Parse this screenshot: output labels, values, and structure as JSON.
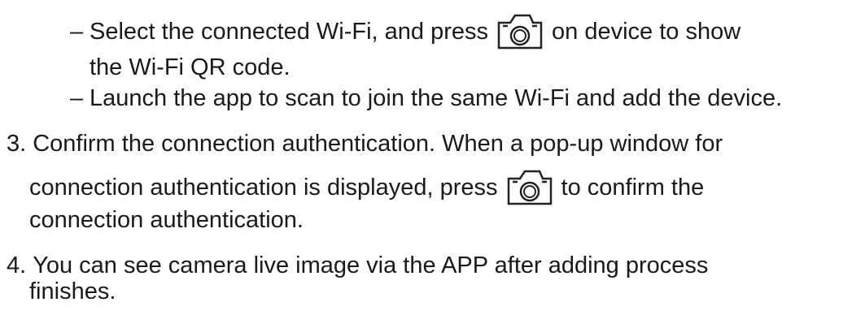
{
  "instructions": {
    "sub_steps": [
      {
        "marker": "–",
        "text_before": "Select the connected Wi-Fi, and press",
        "icon": "camera-icon",
        "text_after": "on device to show",
        "continuation": "the Wi-Fi QR code."
      },
      {
        "marker": "–",
        "text": "Launch the app to scan to join the same Wi-Fi and add the device."
      }
    ],
    "steps": [
      {
        "number": "3.",
        "line1": "Confirm the connection authentication. When a pop-up window for",
        "line2_before": "connection authentication is displayed, press",
        "icon": "camera-icon",
        "line2_after": "to confirm the",
        "line3": "connection authentication."
      },
      {
        "number": "4.",
        "line1": "You can see camera live image via the APP after adding process",
        "line2": "finishes."
      }
    ]
  }
}
